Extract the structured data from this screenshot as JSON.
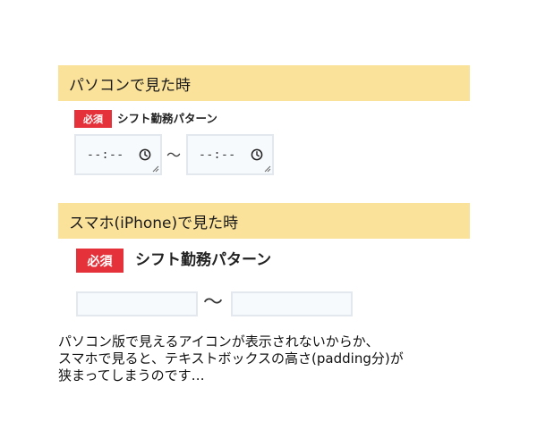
{
  "pc_view": {
    "header": "パソコンで見た時",
    "badge": "必須",
    "label": "シフト勤務パターン",
    "time_inputs": [
      {
        "value": "--:--"
      },
      {
        "value": "--:--"
      }
    ],
    "separator": "～"
  },
  "sp_view": {
    "header": "スマホ(iPhone)で見た時",
    "badge": "必須",
    "label": "シフト勤務パターン",
    "separator": "～"
  },
  "note_lines": [
    "パソコン版で見えるアイコンが表示されないからか、",
    "スマホで見ると、テキストボックスの高さ(padding分)が",
    "狭まってしまうのです…"
  ],
  "colors": {
    "header_bg": "#fbe29a",
    "badge_bg": "#e5323a",
    "input_border": "#e3e8ee",
    "input_bg": "#f7fafd"
  },
  "icons": {
    "time_input_icon": "clock-icon",
    "resize_handle": "resize-grip-icon"
  }
}
